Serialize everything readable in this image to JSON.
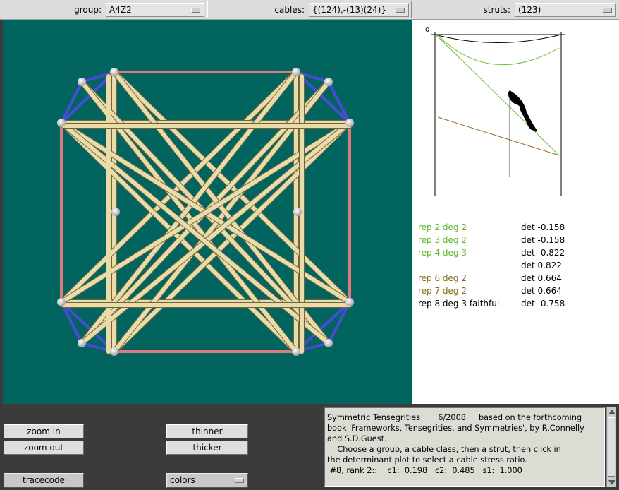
{
  "toolbar": {
    "group_label": "group:",
    "group_value": "A4Z2",
    "cables_label": "cables:",
    "cables_value": "{(124),-(13)(24)}",
    "struts_label": "struts:",
    "struts_value": "(123)"
  },
  "plot": {
    "zero_label": "0",
    "colors": {
      "black_curve": "#000000",
      "green": "#6cbf2e",
      "brown": "#a0641e",
      "axis": "#000000"
    }
  },
  "reps": [
    {
      "name": "rep 2 deg 2",
      "det": "det -0.158",
      "color": "#5fb52b"
    },
    {
      "name": "rep 3 deg 2",
      "det": "det -0.158",
      "color": "#5fb52b"
    },
    {
      "name": "rep 4 deg 3",
      "det": "det -0.822",
      "color": "#5fb52b"
    },
    {
      "name": "",
      "det": "det 0.822",
      "color": "#000000"
    },
    {
      "name": "rep 6 deg 2",
      "det": "det 0.664",
      "color": "#8a6a14"
    },
    {
      "name": "rep 7 deg 2",
      "det": "det 0.664",
      "color": "#8a6a14"
    },
    {
      "name": "rep 8 deg 3  faithful",
      "det": "det -0.758",
      "color": "#000000"
    }
  ],
  "buttons": {
    "zoom_in": "zoom in",
    "zoom_out": "zoom out",
    "thinner": "thinner",
    "thicker": "thicker",
    "tracecode": "tracecode",
    "colors": "colors"
  },
  "info": {
    "lines": [
      "Symmetric Tensegrities       6/2008     based on the forthcoming",
      "book 'Frameworks, Tensegrities, and Symmetries', by R.Connelly",
      "and S.D.Guest.",
      "    Choose a group, a cable class, then a strut, then click in",
      "the determinant plot to select a cable stress ratio.",
      " #8, rank 2::    c1:  0.198   c2:  0.485   s1:  1.000"
    ]
  },
  "viewport": {
    "background": "#02645f",
    "strut_color": "#e9dca8",
    "cable_red": "#e07a80",
    "cable_blue": "#4a4ad8"
  }
}
